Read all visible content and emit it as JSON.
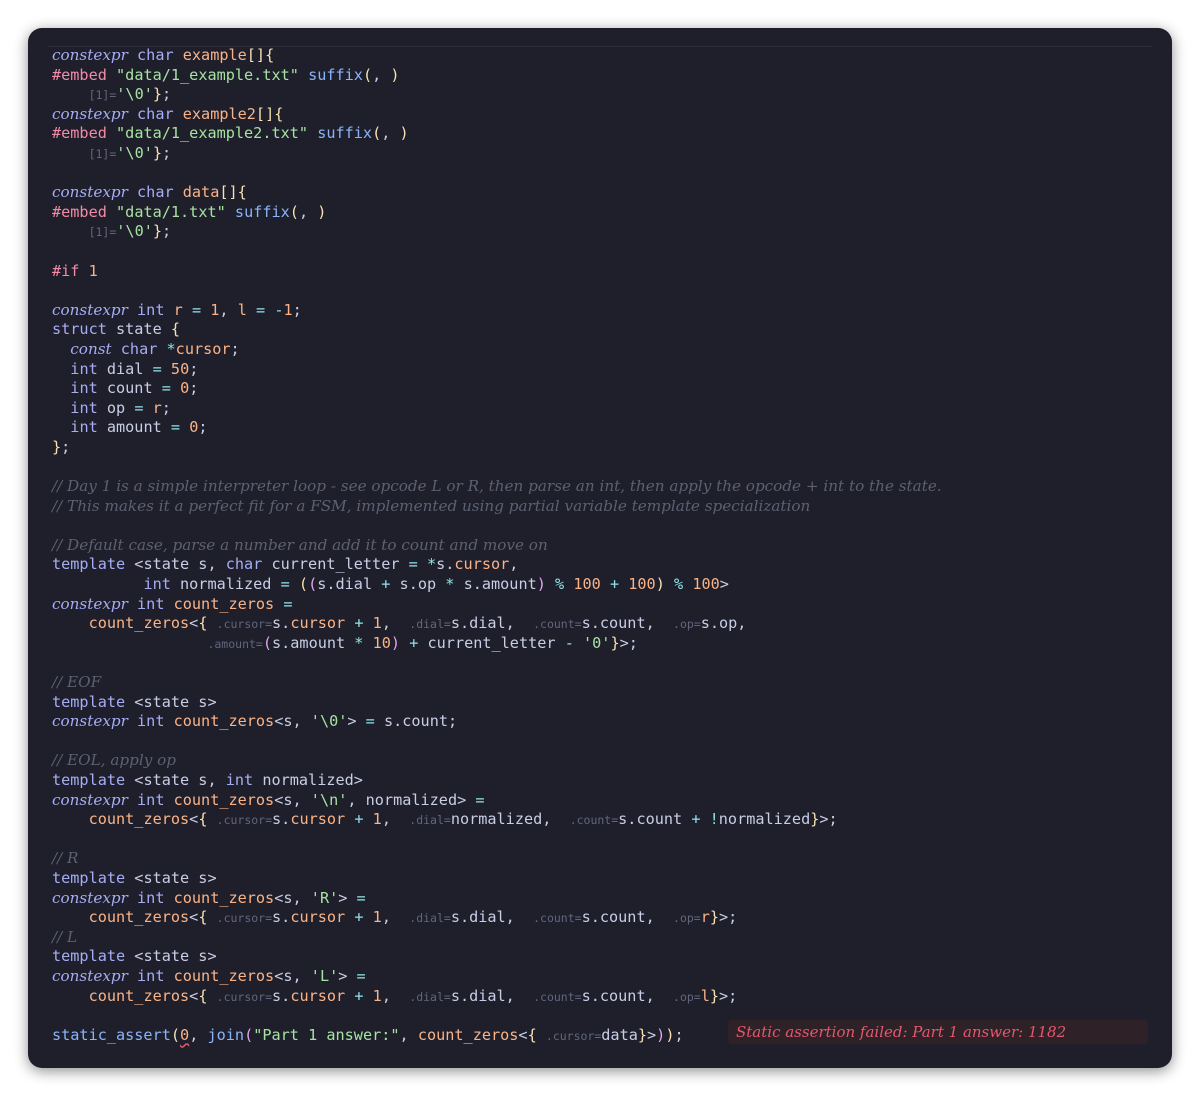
{
  "editor": {
    "lines": [
      [
        [
          "kwi",
          "constexpr"
        ],
        [
          "txt",
          " "
        ],
        [
          "kw",
          "char"
        ],
        [
          "txt",
          " "
        ],
        [
          "var",
          "example"
        ],
        [
          "p1",
          "[]{"
        ]
      ],
      [
        [
          "pp",
          "#embed"
        ],
        [
          "txt",
          " "
        ],
        [
          "str",
          "\"data/1_example.txt\""
        ],
        [
          "txt",
          " "
        ],
        [
          "fn",
          "suffix"
        ],
        [
          "p1",
          "("
        ],
        [
          "txt",
          ", "
        ],
        [
          "p1",
          ")"
        ]
      ],
      [
        [
          "txt",
          "    "
        ],
        [
          "hint",
          "[1]="
        ],
        [
          "str",
          "'\\0'"
        ],
        [
          "p1",
          "}"
        ],
        [
          "txt",
          ";"
        ]
      ],
      [
        [
          "kwi",
          "constexpr"
        ],
        [
          "txt",
          " "
        ],
        [
          "kw",
          "char"
        ],
        [
          "txt",
          " "
        ],
        [
          "var",
          "example2"
        ],
        [
          "p1",
          "[]{"
        ]
      ],
      [
        [
          "pp",
          "#embed"
        ],
        [
          "txt",
          " "
        ],
        [
          "str",
          "\"data/1_example2.txt\""
        ],
        [
          "txt",
          " "
        ],
        [
          "fn",
          "suffix"
        ],
        [
          "p1",
          "("
        ],
        [
          "txt",
          ", "
        ],
        [
          "p1",
          ")"
        ]
      ],
      [
        [
          "txt",
          "    "
        ],
        [
          "hint",
          "[1]="
        ],
        [
          "str",
          "'\\0'"
        ],
        [
          "p1",
          "}"
        ],
        [
          "txt",
          ";"
        ]
      ],
      [],
      [
        [
          "kwi",
          "constexpr"
        ],
        [
          "txt",
          " "
        ],
        [
          "kw",
          "char"
        ],
        [
          "txt",
          " "
        ],
        [
          "var",
          "data"
        ],
        [
          "p1",
          "[]{"
        ]
      ],
      [
        [
          "pp",
          "#embed"
        ],
        [
          "txt",
          " "
        ],
        [
          "str",
          "\"data/1.txt\""
        ],
        [
          "txt",
          " "
        ],
        [
          "fn",
          "suffix"
        ],
        [
          "p1",
          "("
        ],
        [
          "txt",
          ", "
        ],
        [
          "p1",
          ")"
        ]
      ],
      [
        [
          "txt",
          "    "
        ],
        [
          "hint",
          "[1]="
        ],
        [
          "str",
          "'\\0'"
        ],
        [
          "p1",
          "}"
        ],
        [
          "txt",
          ";"
        ]
      ],
      [],
      [
        [
          "pp",
          "#if"
        ],
        [
          "txt",
          " "
        ],
        [
          "num",
          "1"
        ]
      ],
      [],
      [
        [
          "kwi",
          "constexpr"
        ],
        [
          "txt",
          " "
        ],
        [
          "kw",
          "int"
        ],
        [
          "txt",
          " "
        ],
        [
          "var",
          "r"
        ],
        [
          "txt",
          " "
        ],
        [
          "op",
          "="
        ],
        [
          "txt",
          " "
        ],
        [
          "num",
          "1"
        ],
        [
          "txt",
          ", "
        ],
        [
          "var",
          "l"
        ],
        [
          "txt",
          " "
        ],
        [
          "op",
          "="
        ],
        [
          "txt",
          " "
        ],
        [
          "op",
          "-"
        ],
        [
          "num",
          "1"
        ],
        [
          "txt",
          ";"
        ]
      ],
      [
        [
          "kw",
          "struct"
        ],
        [
          "txt",
          " state "
        ],
        [
          "p1",
          "{"
        ]
      ],
      [
        [
          "txt",
          "  "
        ],
        [
          "kwi",
          "const"
        ],
        [
          "txt",
          " "
        ],
        [
          "kw",
          "char"
        ],
        [
          "txt",
          " "
        ],
        [
          "op",
          "*"
        ],
        [
          "var",
          "cursor"
        ],
        [
          "txt",
          ";"
        ]
      ],
      [
        [
          "txt",
          "  "
        ],
        [
          "kw",
          "int"
        ],
        [
          "txt",
          " dial "
        ],
        [
          "op",
          "="
        ],
        [
          "txt",
          " "
        ],
        [
          "num",
          "50"
        ],
        [
          "txt",
          ";"
        ]
      ],
      [
        [
          "txt",
          "  "
        ],
        [
          "kw",
          "int"
        ],
        [
          "txt",
          " count "
        ],
        [
          "op",
          "="
        ],
        [
          "txt",
          " "
        ],
        [
          "num",
          "0"
        ],
        [
          "txt",
          ";"
        ]
      ],
      [
        [
          "txt",
          "  "
        ],
        [
          "kw",
          "int"
        ],
        [
          "txt",
          " op "
        ],
        [
          "op",
          "="
        ],
        [
          "txt",
          " "
        ],
        [
          "var",
          "r"
        ],
        [
          "txt",
          ";"
        ]
      ],
      [
        [
          "txt",
          "  "
        ],
        [
          "kw",
          "int"
        ],
        [
          "txt",
          " amount "
        ],
        [
          "op",
          "="
        ],
        [
          "txt",
          " "
        ],
        [
          "num",
          "0"
        ],
        [
          "txt",
          ";"
        ]
      ],
      [
        [
          "p1",
          "}"
        ],
        [
          "txt",
          ";"
        ]
      ],
      [],
      [
        [
          "com",
          "// Day 1 is a simple interpreter loop - see opcode L or R, then parse an int, then apply the opcode + int to the state."
        ]
      ],
      [
        [
          "com",
          "// This makes it a perfect fit for a FSM, implemented using partial variable template specialization"
        ]
      ],
      [],
      [
        [
          "com",
          "// Default case, parse a number and add it to count and move on"
        ]
      ],
      [
        [
          "kw",
          "template"
        ],
        [
          "txt",
          " <state s, "
        ],
        [
          "kw",
          "char"
        ],
        [
          "txt",
          " current_letter "
        ],
        [
          "op",
          "="
        ],
        [
          "txt",
          " "
        ],
        [
          "op",
          "*"
        ],
        [
          "txt",
          "s."
        ],
        [
          "var",
          "cursor"
        ],
        [
          "txt",
          ","
        ]
      ],
      [
        [
          "txt",
          "          "
        ],
        [
          "kw",
          "int"
        ],
        [
          "txt",
          " normalized "
        ],
        [
          "op",
          "="
        ],
        [
          "txt",
          " "
        ],
        [
          "p1",
          "("
        ],
        [
          "p2",
          "("
        ],
        [
          "txt",
          "s.dial "
        ],
        [
          "op",
          "+"
        ],
        [
          "txt",
          " s.op "
        ],
        [
          "op",
          "*"
        ],
        [
          "txt",
          " s.amount"
        ],
        [
          "p2",
          ")"
        ],
        [
          "txt",
          " "
        ],
        [
          "op",
          "%"
        ],
        [
          "txt",
          " "
        ],
        [
          "num",
          "100"
        ],
        [
          "txt",
          " "
        ],
        [
          "op",
          "+"
        ],
        [
          "txt",
          " "
        ],
        [
          "num",
          "100"
        ],
        [
          "p1",
          ")"
        ],
        [
          "txt",
          " "
        ],
        [
          "op",
          "%"
        ],
        [
          "txt",
          " "
        ],
        [
          "num",
          "100"
        ],
        [
          "txt",
          ">"
        ]
      ],
      [
        [
          "kwi",
          "constexpr"
        ],
        [
          "txt",
          " "
        ],
        [
          "kw",
          "int"
        ],
        [
          "txt",
          " "
        ],
        [
          "var",
          "count_zeros"
        ],
        [
          "txt",
          " "
        ],
        [
          "op",
          "="
        ]
      ],
      [
        [
          "txt",
          "    "
        ],
        [
          "var",
          "count_zeros"
        ],
        [
          "txt",
          "<"
        ],
        [
          "p1",
          "{"
        ],
        [
          "txt",
          " "
        ],
        [
          "hint",
          ".cursor="
        ],
        [
          "txt",
          "s."
        ],
        [
          "var",
          "cursor"
        ],
        [
          "txt",
          " "
        ],
        [
          "op",
          "+"
        ],
        [
          "txt",
          " "
        ],
        [
          "num",
          "1"
        ],
        [
          "txt",
          ",  "
        ],
        [
          "hint",
          ".dial="
        ],
        [
          "txt",
          "s.dial,  "
        ],
        [
          "hint",
          ".count="
        ],
        [
          "txt",
          "s.count,  "
        ],
        [
          "hint",
          ".op="
        ],
        [
          "txt",
          "s.op,"
        ]
      ],
      [
        [
          "txt",
          "                 "
        ],
        [
          "hint",
          ".amount="
        ],
        [
          "p2",
          "("
        ],
        [
          "txt",
          "s.amount "
        ],
        [
          "op",
          "*"
        ],
        [
          "txt",
          " "
        ],
        [
          "num",
          "10"
        ],
        [
          "p2",
          ")"
        ],
        [
          "txt",
          " "
        ],
        [
          "op",
          "+"
        ],
        [
          "txt",
          " current_letter "
        ],
        [
          "op",
          "-"
        ],
        [
          "txt",
          " "
        ],
        [
          "str",
          "'0'"
        ],
        [
          "p1",
          "}"
        ],
        [
          "txt",
          ">;"
        ]
      ],
      [],
      [
        [
          "com",
          "// EOF"
        ]
      ],
      [
        [
          "kw",
          "template"
        ],
        [
          "txt",
          " <state s>"
        ]
      ],
      [
        [
          "kwi",
          "constexpr"
        ],
        [
          "txt",
          " "
        ],
        [
          "kw",
          "int"
        ],
        [
          "txt",
          " "
        ],
        [
          "var",
          "count_zeros"
        ],
        [
          "txt",
          "<s, "
        ],
        [
          "str",
          "'\\0'"
        ],
        [
          "txt",
          "> "
        ],
        [
          "op",
          "="
        ],
        [
          "txt",
          " s.count;"
        ]
      ],
      [],
      [
        [
          "com",
          "// EOL, apply op"
        ]
      ],
      [
        [
          "kw",
          "template"
        ],
        [
          "txt",
          " <state s, "
        ],
        [
          "kw",
          "int"
        ],
        [
          "txt",
          " normalized>"
        ]
      ],
      [
        [
          "kwi",
          "constexpr"
        ],
        [
          "txt",
          " "
        ],
        [
          "kw",
          "int"
        ],
        [
          "txt",
          " "
        ],
        [
          "var",
          "count_zeros"
        ],
        [
          "txt",
          "<s, "
        ],
        [
          "str",
          "'\\n'"
        ],
        [
          "txt",
          ", normalized> "
        ],
        [
          "op",
          "="
        ]
      ],
      [
        [
          "txt",
          "    "
        ],
        [
          "var",
          "count_zeros"
        ],
        [
          "txt",
          "<"
        ],
        [
          "p1",
          "{"
        ],
        [
          "txt",
          " "
        ],
        [
          "hint",
          ".cursor="
        ],
        [
          "txt",
          "s."
        ],
        [
          "var",
          "cursor"
        ],
        [
          "txt",
          " "
        ],
        [
          "op",
          "+"
        ],
        [
          "txt",
          " "
        ],
        [
          "num",
          "1"
        ],
        [
          "txt",
          ",  "
        ],
        [
          "hint",
          ".dial="
        ],
        [
          "txt",
          "normalized,  "
        ],
        [
          "hint",
          ".count="
        ],
        [
          "txt",
          "s.count "
        ],
        [
          "op",
          "+"
        ],
        [
          "txt",
          " "
        ],
        [
          "op",
          "!"
        ],
        [
          "txt",
          "normalized"
        ],
        [
          "p1",
          "}"
        ],
        [
          "txt",
          ">;"
        ]
      ],
      [],
      [
        [
          "com",
          "// R"
        ]
      ],
      [
        [
          "kw",
          "template"
        ],
        [
          "txt",
          " <state s>"
        ]
      ],
      [
        [
          "kwi",
          "constexpr"
        ],
        [
          "txt",
          " "
        ],
        [
          "kw",
          "int"
        ],
        [
          "txt",
          " "
        ],
        [
          "var",
          "count_zeros"
        ],
        [
          "txt",
          "<s, "
        ],
        [
          "str",
          "'R'"
        ],
        [
          "txt",
          "> "
        ],
        [
          "op",
          "="
        ]
      ],
      [
        [
          "txt",
          "    "
        ],
        [
          "var",
          "count_zeros"
        ],
        [
          "txt",
          "<"
        ],
        [
          "p1",
          "{"
        ],
        [
          "txt",
          " "
        ],
        [
          "hint",
          ".cursor="
        ],
        [
          "txt",
          "s."
        ],
        [
          "var",
          "cursor"
        ],
        [
          "txt",
          " "
        ],
        [
          "op",
          "+"
        ],
        [
          "txt",
          " "
        ],
        [
          "num",
          "1"
        ],
        [
          "txt",
          ",  "
        ],
        [
          "hint",
          ".dial="
        ],
        [
          "txt",
          "s.dial,  "
        ],
        [
          "hint",
          ".count="
        ],
        [
          "txt",
          "s.count,  "
        ],
        [
          "hint",
          ".op="
        ],
        [
          "var",
          "r"
        ],
        [
          "p1",
          "}"
        ],
        [
          "txt",
          ">;"
        ]
      ],
      [
        [
          "com",
          "// L"
        ]
      ],
      [
        [
          "kw",
          "template"
        ],
        [
          "txt",
          " <state s>"
        ]
      ],
      [
        [
          "kwi",
          "constexpr"
        ],
        [
          "txt",
          " "
        ],
        [
          "kw",
          "int"
        ],
        [
          "txt",
          " "
        ],
        [
          "var",
          "count_zeros"
        ],
        [
          "txt",
          "<s, "
        ],
        [
          "str",
          "'L'"
        ],
        [
          "txt",
          "> "
        ],
        [
          "op",
          "="
        ]
      ],
      [
        [
          "txt",
          "    "
        ],
        [
          "var",
          "count_zeros"
        ],
        [
          "txt",
          "<"
        ],
        [
          "p1",
          "{"
        ],
        [
          "txt",
          " "
        ],
        [
          "hint",
          ".cursor="
        ],
        [
          "txt",
          "s."
        ],
        [
          "var",
          "cursor"
        ],
        [
          "txt",
          " "
        ],
        [
          "op",
          "+"
        ],
        [
          "txt",
          " "
        ],
        [
          "num",
          "1"
        ],
        [
          "txt",
          ",  "
        ],
        [
          "hint",
          ".dial="
        ],
        [
          "txt",
          "s.dial,  "
        ],
        [
          "hint",
          ".count="
        ],
        [
          "txt",
          "s.count,  "
        ],
        [
          "hint",
          ".op="
        ],
        [
          "var",
          "l"
        ],
        [
          "p1",
          "}"
        ],
        [
          "txt",
          ">;"
        ]
      ],
      [],
      [
        [
          "fn",
          "static_assert"
        ],
        [
          "p1",
          "("
        ],
        [
          "num",
          "0"
        ],
        [
          "txt",
          ", "
        ],
        [
          "fn",
          "join"
        ],
        [
          "p2",
          "("
        ],
        [
          "str",
          "\"Part 1 answer:\""
        ],
        [
          "txt",
          ", "
        ],
        [
          "var",
          "count_zeros"
        ],
        [
          "txt",
          "<"
        ],
        [
          "p1",
          "{"
        ],
        [
          "txt",
          " "
        ],
        [
          "hint",
          ".cursor="
        ],
        [
          "txt",
          "data"
        ],
        [
          "p1",
          "}"
        ],
        [
          "txt",
          ">"
        ],
        [
          "p2",
          ")"
        ],
        [
          "p1",
          ")"
        ],
        [
          "txt",
          ";"
        ]
      ]
    ]
  },
  "diagnostic": {
    "message": "Static assertion failed: Part 1 answer: 1182"
  },
  "colors": {
    "background": "#1e1f2b",
    "error": "#e5576b"
  }
}
